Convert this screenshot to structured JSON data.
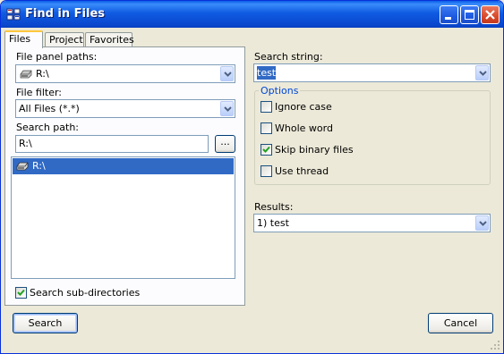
{
  "window": {
    "title": "Find in Files"
  },
  "tabs": [
    "Files",
    "Project",
    "Favorites"
  ],
  "files_panel": {
    "panel_paths_label": "File panel paths:",
    "panel_paths_value": "R:\\",
    "file_filter_label": "File filter:",
    "file_filter_value": "All Files (*.*)",
    "search_path_label": "Search path:",
    "search_path_value": "R:\\",
    "browse_label": "...",
    "path_list": [
      "R:\\"
    ],
    "subdirs_label": "Search sub-directories",
    "subdirs_checked": true
  },
  "search": {
    "string_label": "Search string:",
    "string_value": "test"
  },
  "options": {
    "title": "Options",
    "items": [
      {
        "label": "Ignore case",
        "checked": false
      },
      {
        "label": "Whole word",
        "checked": false
      },
      {
        "label": "Skip binary files",
        "checked": true
      },
      {
        "label": "Use thread",
        "checked": false
      }
    ]
  },
  "results": {
    "label": "Results:",
    "value": "1) test"
  },
  "buttons": {
    "search": "Search",
    "cancel": "Cancel"
  }
}
